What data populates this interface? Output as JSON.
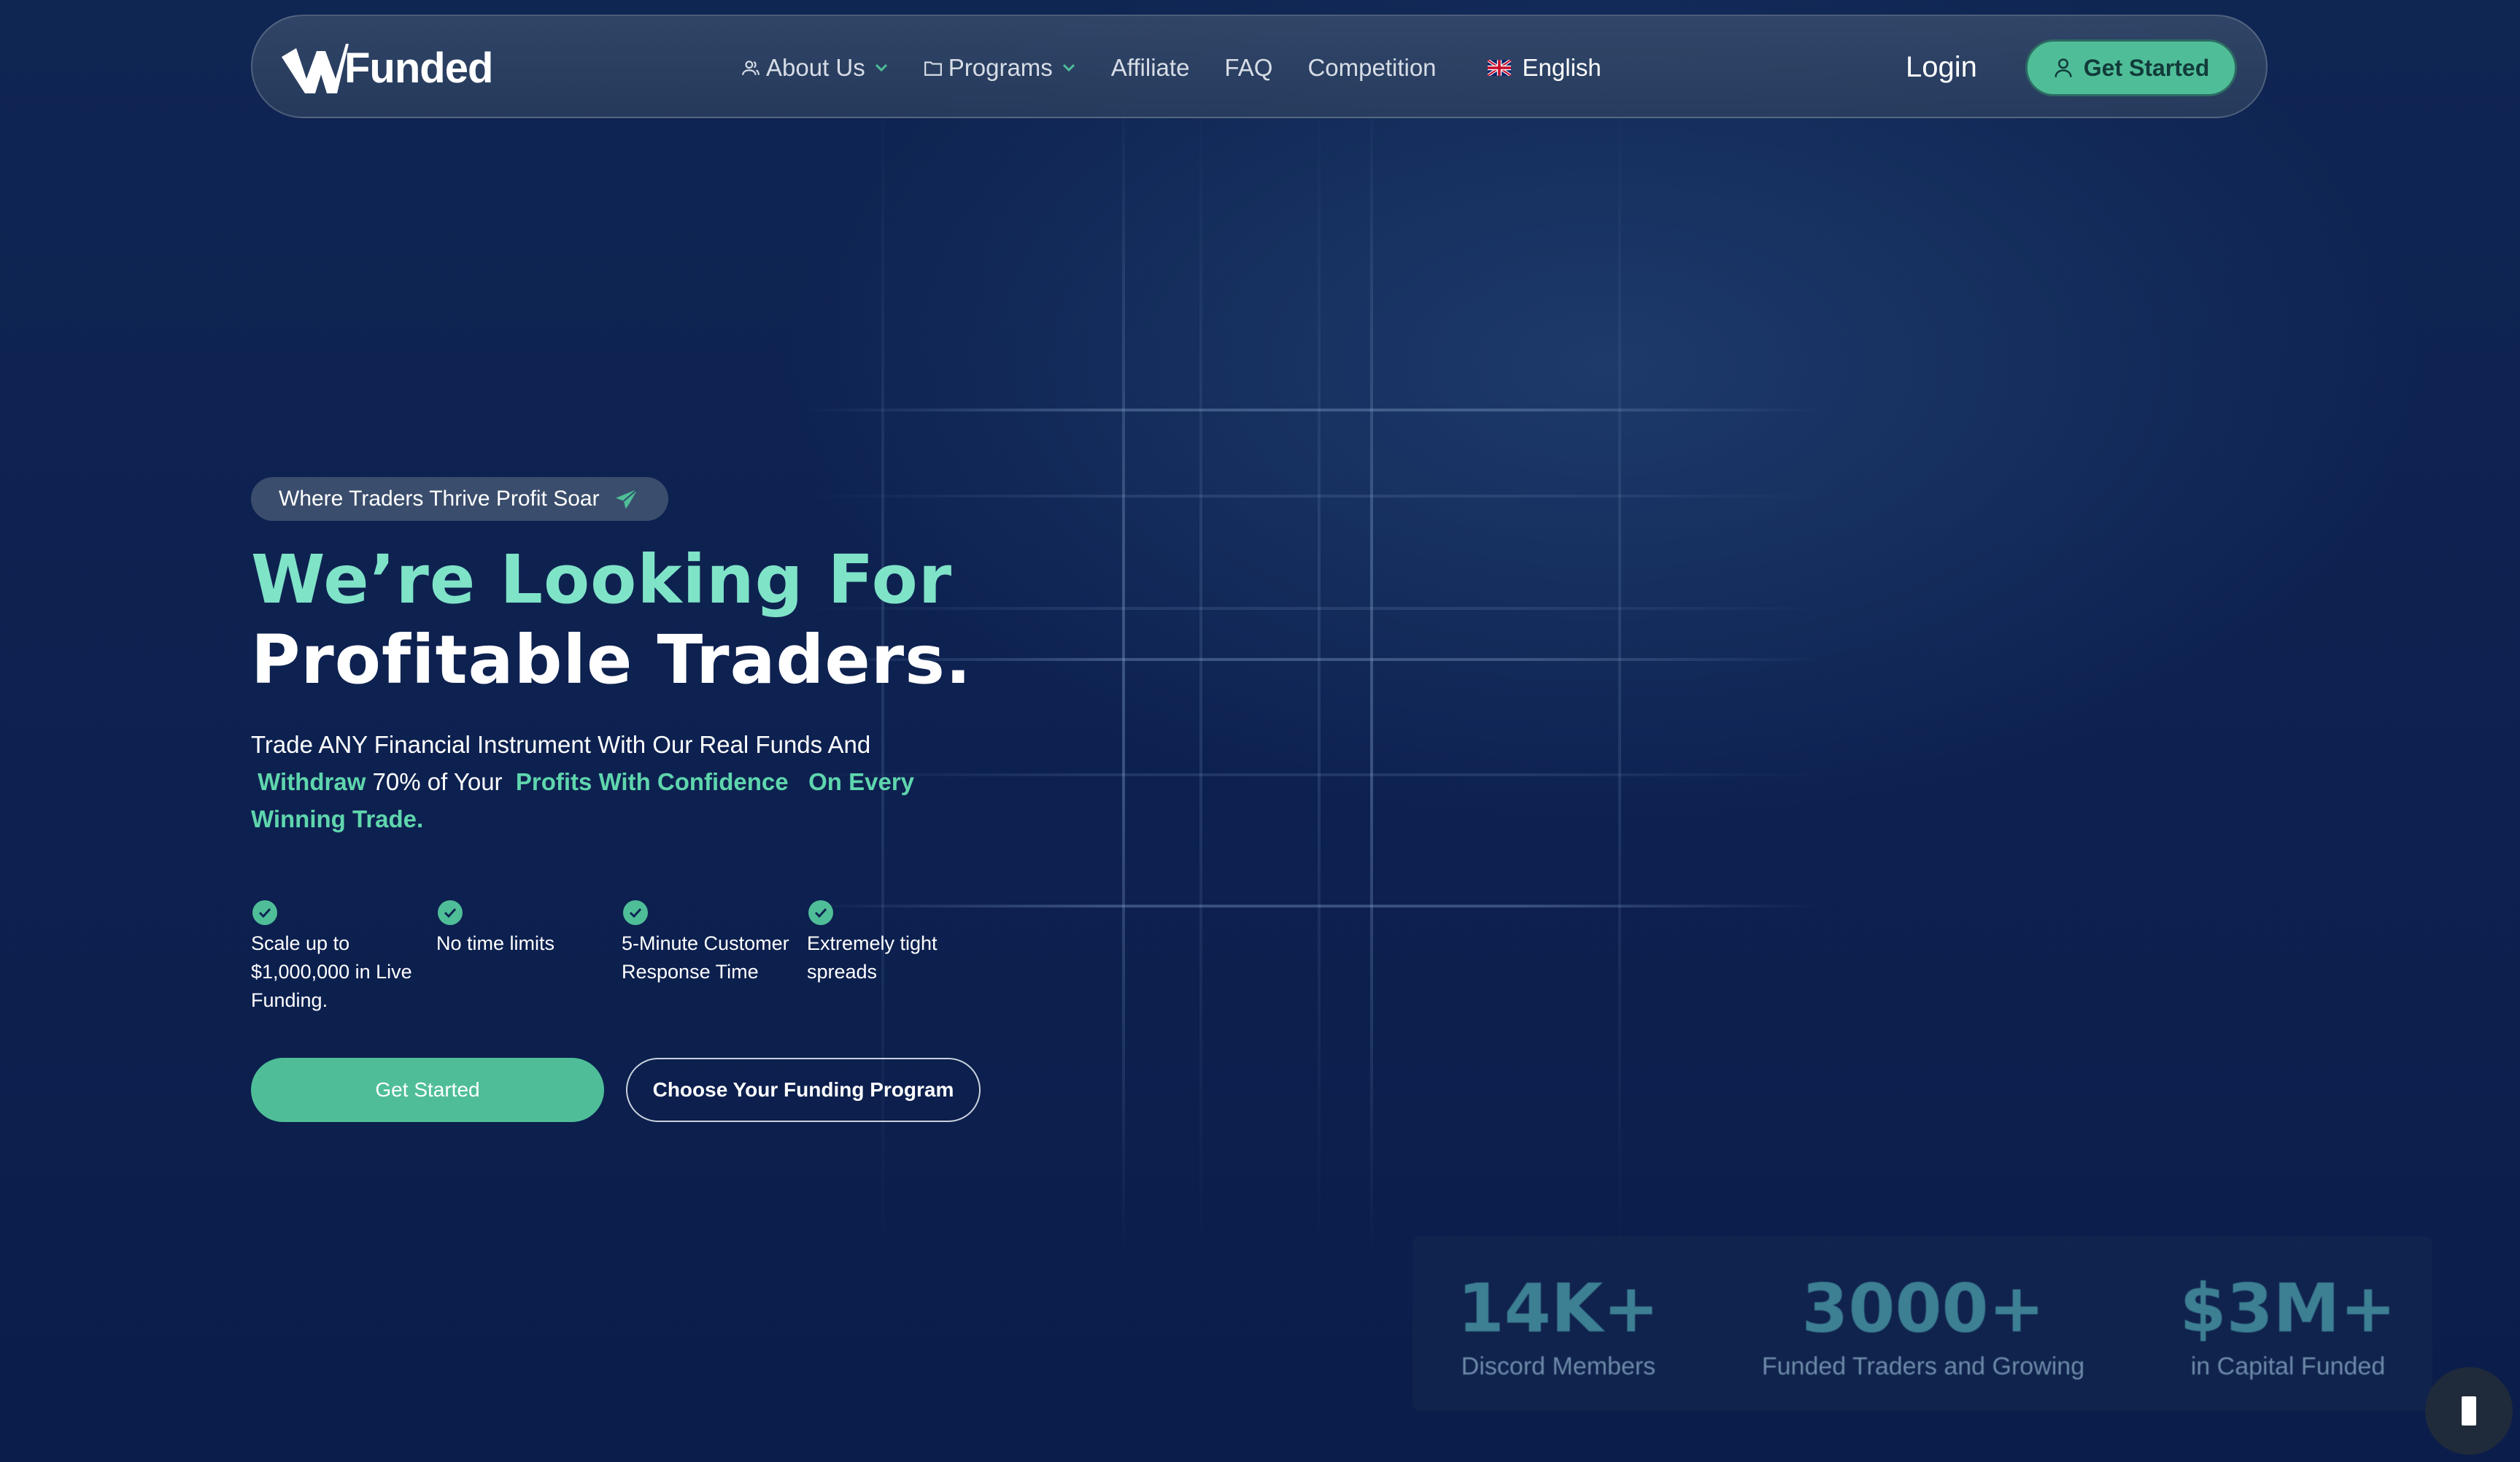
{
  "brand": {
    "name": "Funded",
    "accent": "#4fbe98",
    "title_accent": "#7fe3c8",
    "background": "#0f2552"
  },
  "nav": {
    "items": [
      {
        "label": "About Us",
        "icon": "user-icon",
        "dropdown": true
      },
      {
        "label": "Programs",
        "icon": "folder-icon",
        "dropdown": true
      },
      {
        "label": "Affiliate"
      },
      {
        "label": "FAQ"
      },
      {
        "label": "Competition"
      }
    ],
    "language": {
      "label": "English",
      "icon": "uk-flag-icon"
    },
    "login": "Login",
    "cta": "Get Started"
  },
  "hero": {
    "tagline": "Where Traders Thrive Profit Soar",
    "title_line1": "We’re Looking For",
    "title_line2": "Profitable Traders.",
    "desc_part1": "Trade ANY Financial Instrument With Our Real Funds And",
    "desc_hl1": "Withdraw",
    "desc_part2": "70% of Your",
    "desc_hl2": "Profits With Confidence",
    "desc_hl3": "On Every Winning Trade.",
    "features": [
      "Scale up to $1,000,000 in Live Funding.",
      "No time limits",
      "5-Minute Customer Response Time",
      "Extremely tight spreads"
    ],
    "primary_button": "Get Started",
    "secondary_button": "Choose Your Funding Program"
  },
  "stats": [
    {
      "value": "14K+",
      "label": "Discord Members"
    },
    {
      "value": "3000+",
      "label": "Funded Traders and Growing"
    },
    {
      "value": "$3M+",
      "label": "in Capital Funded"
    }
  ]
}
